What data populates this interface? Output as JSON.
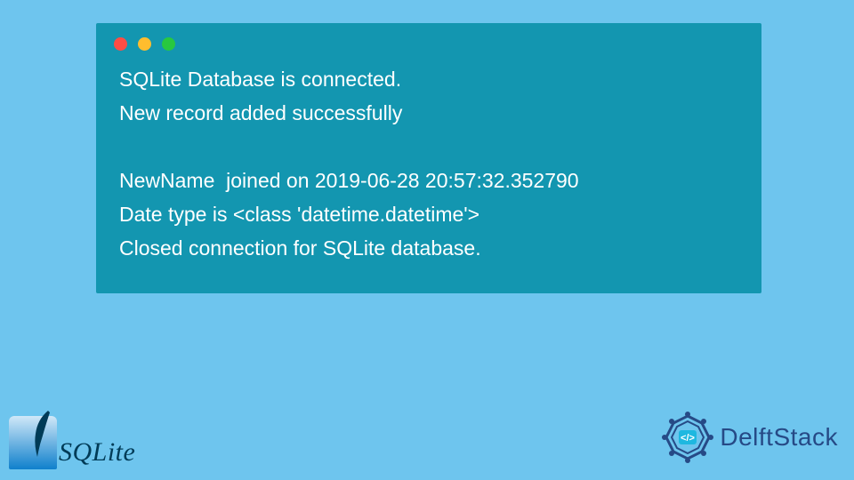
{
  "terminal": {
    "lines": [
      "SQLite Database is connected.",
      "New record added successfully",
      "",
      "NewName  joined on 2019-06-28 20:57:32.352790",
      "Date type is <class 'datetime.datetime'>",
      "Closed connection for SQLite database."
    ]
  },
  "logos": {
    "sqlite": "SQLite",
    "delftstack": "DelftStack"
  }
}
